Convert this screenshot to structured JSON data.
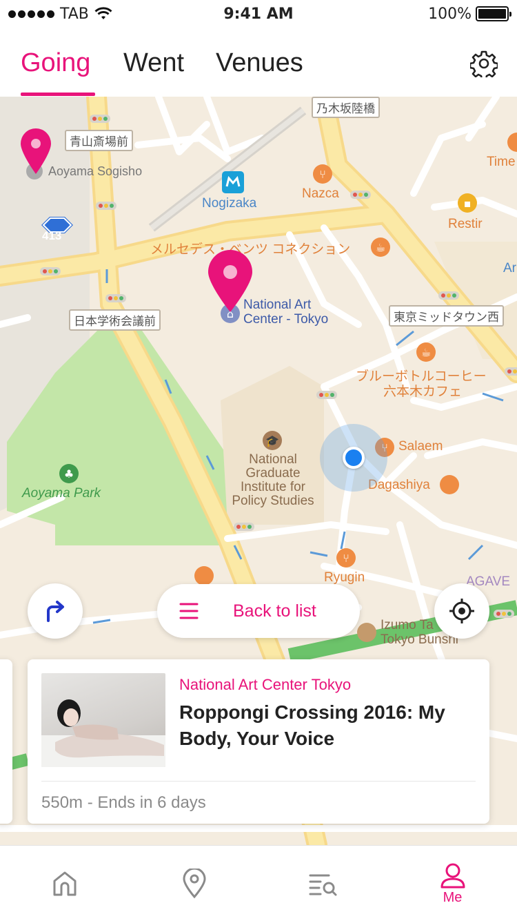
{
  "status_bar": {
    "carrier": "TAB",
    "time": "9:41 AM",
    "battery": "100%"
  },
  "colors": {
    "accent": "#e8137a",
    "map_bg": "#f4ecdf",
    "park": "#c3e6a8",
    "road_yellow": "#fbe9a6"
  },
  "topnav": {
    "tabs": [
      {
        "label": "Going",
        "active": true
      },
      {
        "label": "Went",
        "active": false
      },
      {
        "label": "Venues",
        "active": false
      }
    ],
    "settings_icon": "gear-icon"
  },
  "map": {
    "labels": {
      "aoyama_sogisho": "Aoyama Sogisho",
      "nogizaka": "Nogizaka",
      "nazca": "Nazca",
      "restir": "Restir",
      "time": "Time",
      "ar": "Ar",
      "mercedes": "メルセデス・ベンツ コネクション",
      "national_art_center_1": "National Art",
      "national_art_center_2": "Center - Tokyo",
      "blue_bottle_1": "ブルーボトルコーヒー",
      "blue_bottle_2": "六本木カフェ",
      "grips_1": "National",
      "grips_2": "Graduate",
      "grips_3": "Institute for",
      "grips_4": "Policy Studies",
      "salaem": "Salaem",
      "dagashiya": "Dagashiya",
      "aoyama_park": "Aoyama Park",
      "ryugin": "Ryugin",
      "agave": "AGAVE",
      "izumo_1": "Izumo Ta",
      "izumo_2": "Tokyo Bunshi",
      "route_number": "413"
    },
    "jp_signs": {
      "nogizaka_rikkyo": "乃木坂陸橋",
      "aoyama_saijo": "青山斎場前",
      "nihon_gakujutsu": "日本学術会議前",
      "tokyo_midtown": "東京ミッドタウン西"
    }
  },
  "controls": {
    "directions_icon": "turn-right-arrow-icon",
    "back_to_list": "Back to list",
    "locate_icon": "crosshair-icon"
  },
  "card": {
    "venue": "National Art Center Tokyo",
    "title": "Roppongi Crossing 2016: My Body, Your Voice",
    "meta": "550m - Ends in 6 days"
  },
  "tabbar": {
    "items": [
      {
        "icon": "home-icon",
        "label": ""
      },
      {
        "icon": "map-pin-icon",
        "label": ""
      },
      {
        "icon": "list-search-icon",
        "label": ""
      },
      {
        "icon": "person-icon",
        "label": "Me"
      }
    ]
  }
}
